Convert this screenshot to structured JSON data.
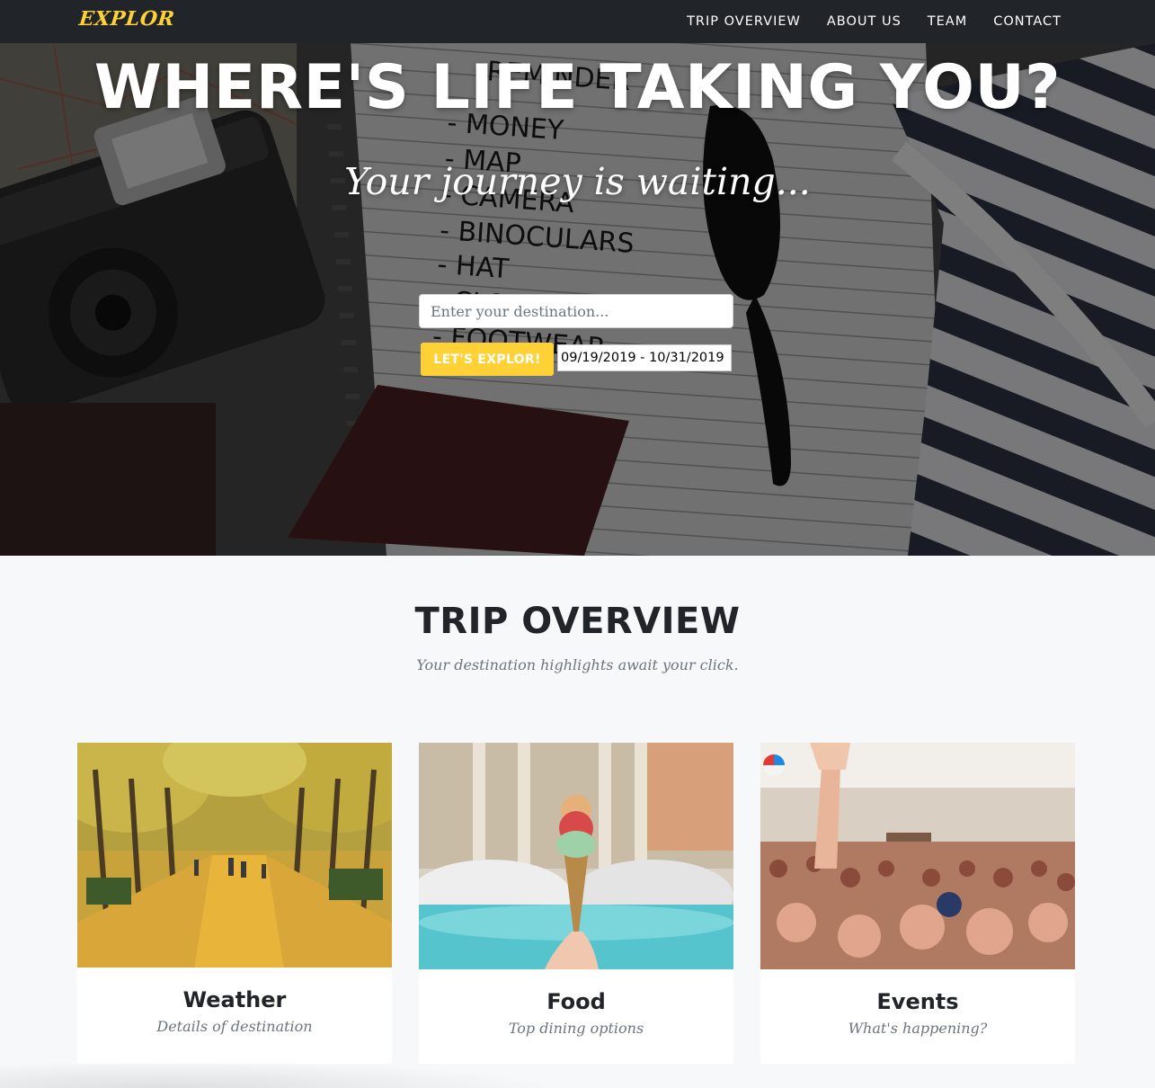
{
  "navbar": {
    "brand": "EXPLOR",
    "links": [
      "TRIP OVERVIEW",
      "ABOUT US",
      "TEAM",
      "CONTACT"
    ]
  },
  "hero": {
    "title": "WHERE'S LIFE TAKING YOU?",
    "subtitle": "Your journey is waiting...",
    "destination_placeholder": "Enter your destination...",
    "explore_button": "LET'S EXPLOR!",
    "date_range_value": "09/19/2019 - 10/31/2019",
    "notebook_text": [
      "REMINDER",
      "- MONEY",
      "- MAP",
      "- CAMERA",
      "- BINOCULARS",
      "- HAT",
      "- CLOTHES",
      "- FOOTWEAR"
    ]
  },
  "overview": {
    "title": "TRIP OVERVIEW",
    "subtitle": "Your destination highlights await your click.",
    "cards": [
      {
        "title": "Weather",
        "text": "Details of destination"
      },
      {
        "title": "Food",
        "text": "Top dining options"
      },
      {
        "title": "Events",
        "text": "What's happening?"
      }
    ]
  },
  "colors": {
    "accent": "#fed136",
    "navbar": "#212529",
    "section_bg": "#f7f8fa",
    "heading": "#212529",
    "muted": "#6c757d"
  }
}
